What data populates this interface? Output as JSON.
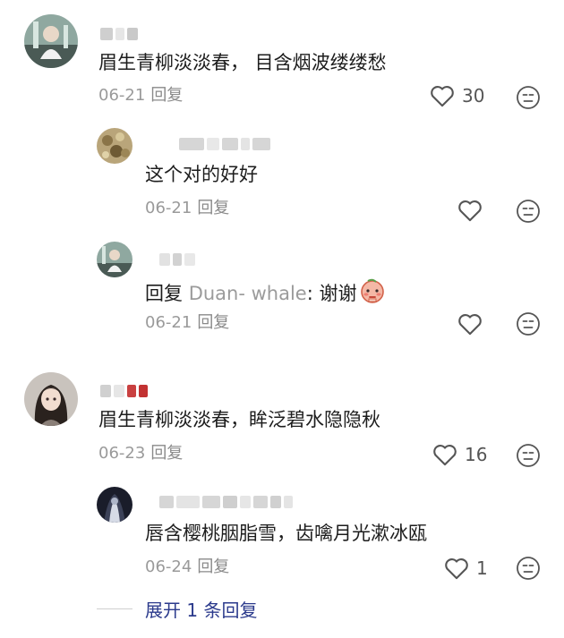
{
  "comments": [
    {
      "text": "眉生青柳淡淡春，  目含烟波缕缕愁",
      "date": "06-21",
      "reply_label": "回复",
      "likes": "30",
      "replies": [
        {
          "text": "这个对的好好",
          "date": "06-21",
          "reply_label": "回复"
        },
        {
          "reply_prefix": "回复",
          "reply_to": "Duan- whale",
          "text": ": 谢谢",
          "date": "06-21",
          "reply_label": "回复"
        }
      ]
    },
    {
      "text": "眉生青柳淡淡春，眸泛碧水隐隐秋",
      "date": "06-23",
      "reply_label": "回复",
      "likes": "16",
      "replies": [
        {
          "text": "唇含樱桃胭脂雪，齿噙月光漱冰瓯",
          "date": "06-24",
          "reply_label": "回复",
          "likes": "1"
        }
      ]
    }
  ],
  "expand_label": "展开 1 条回复",
  "icons": {
    "like": "heart-outline-icon",
    "dislike": "meh-face-icon",
    "emoji": "blushing-face-emoji"
  },
  "colors": {
    "text": "#1d1d1d",
    "meta": "#9a9a9a",
    "link": "#2b3a8c",
    "icon": "#555555"
  }
}
